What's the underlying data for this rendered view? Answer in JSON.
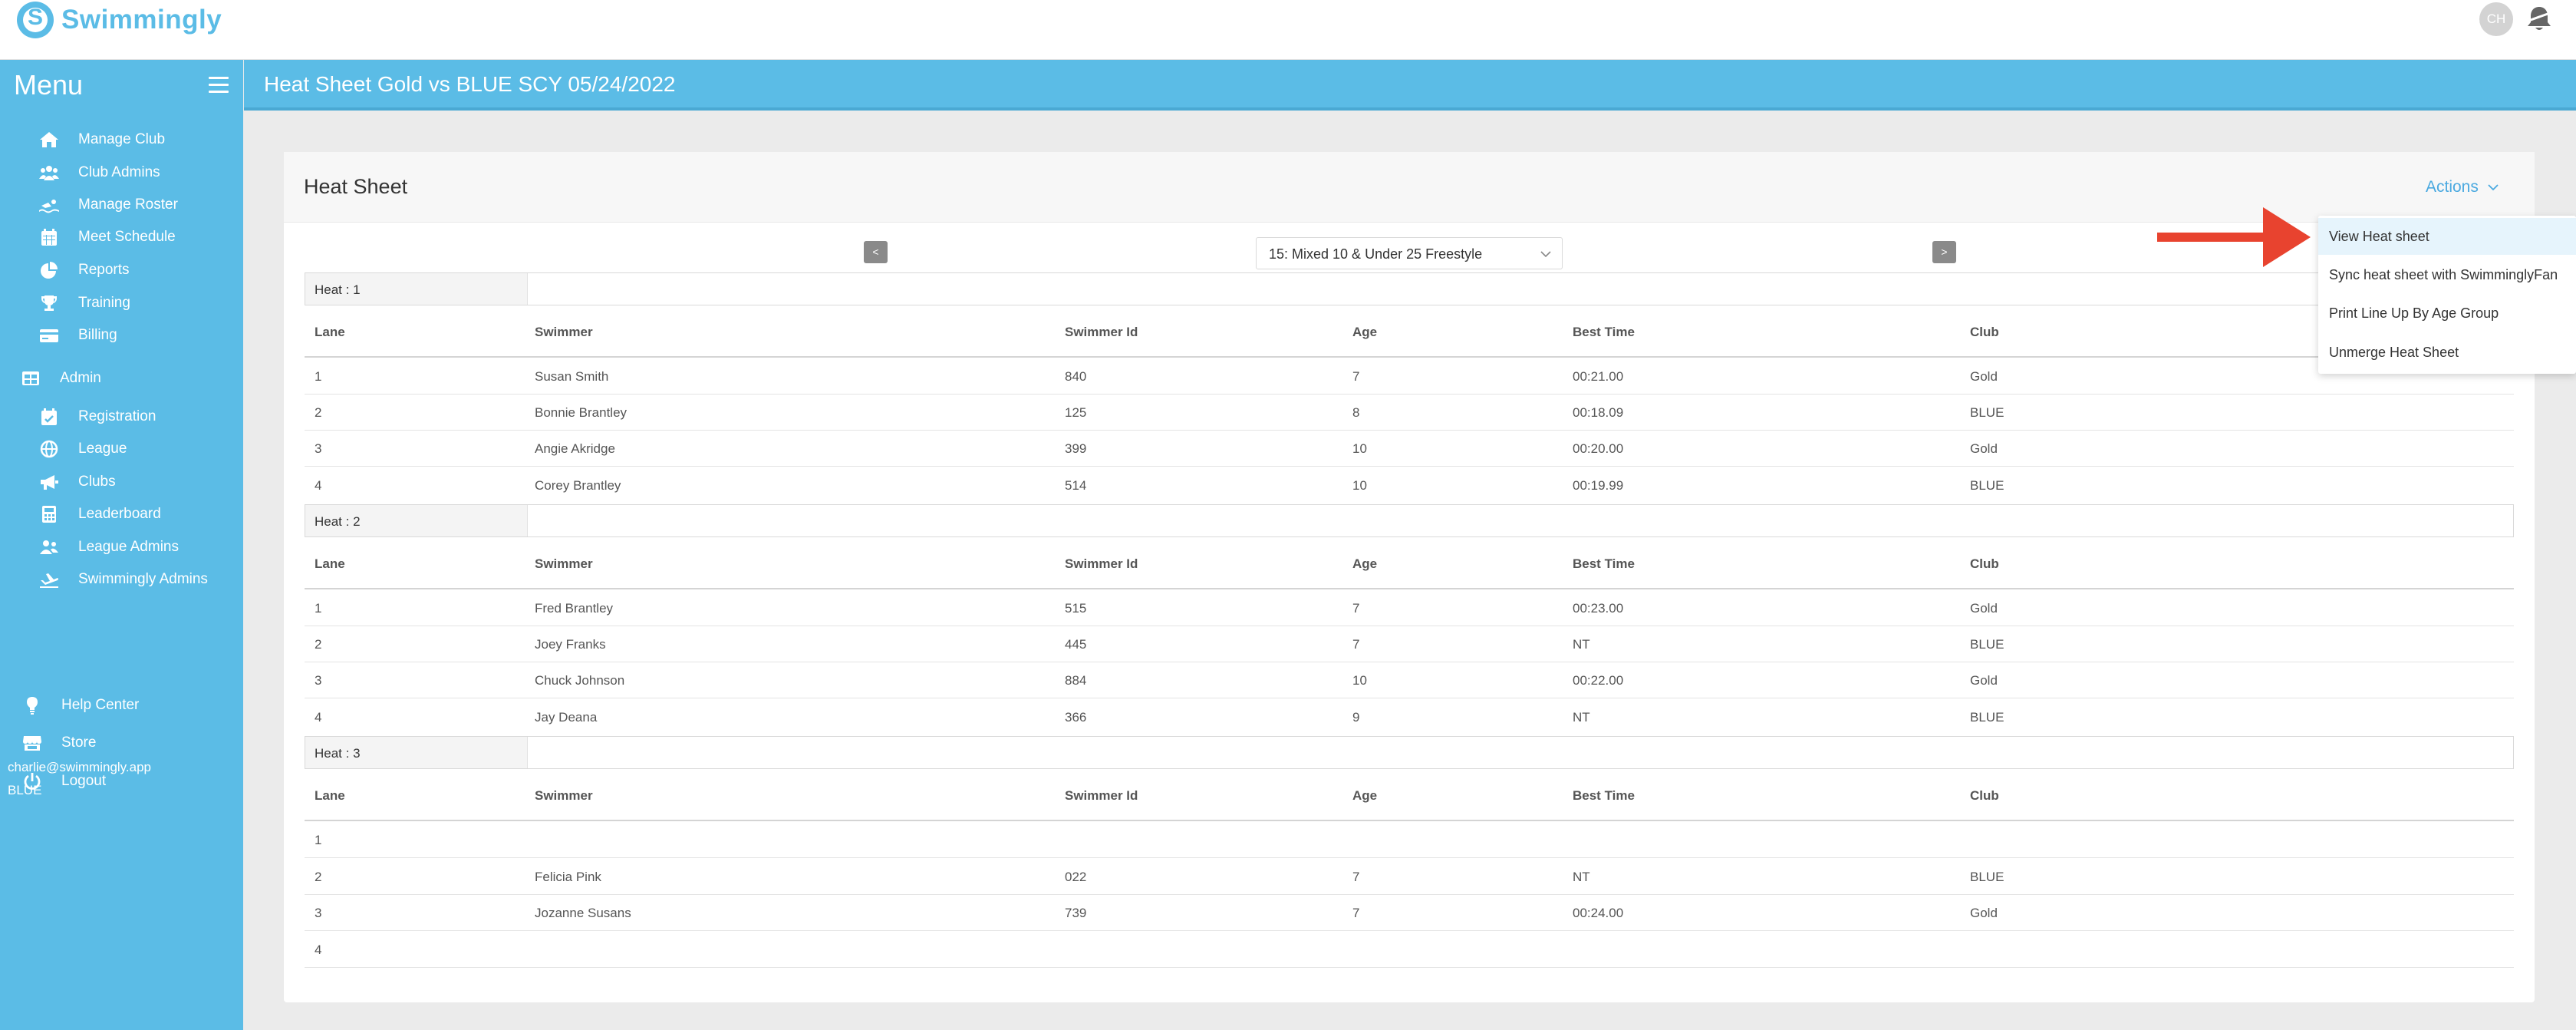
{
  "brand": {
    "name": "Swimmingly"
  },
  "user": {
    "initials": "CH",
    "email": "charlie@swimmingly.app",
    "club": "BLUE"
  },
  "sidebar": {
    "title": "Menu",
    "items": [
      {
        "label": "Manage Club",
        "icon": "home-icon"
      },
      {
        "label": "Club Admins",
        "icon": "users-icon"
      },
      {
        "label": "Manage Roster",
        "icon": "swimmer-icon"
      },
      {
        "label": "Meet Schedule",
        "icon": "calendar-icon"
      },
      {
        "label": "Reports",
        "icon": "pie-chart-icon"
      },
      {
        "label": "Training",
        "icon": "trophy-icon"
      },
      {
        "label": "Billing",
        "icon": "credit-card-icon"
      },
      {
        "label": "Admin",
        "icon": "table-icon"
      },
      {
        "label": "Registration",
        "icon": "calendar-check-icon"
      },
      {
        "label": "League",
        "icon": "globe-icon"
      },
      {
        "label": "Clubs",
        "icon": "megaphone-icon"
      },
      {
        "label": "Leaderboard",
        "icon": "calculator-icon"
      },
      {
        "label": "League Admins",
        "icon": "user-group-icon"
      },
      {
        "label": "Swimmingly Admins",
        "icon": "plane-icon"
      },
      {
        "label": "Help Center",
        "icon": "lightbulb-icon"
      },
      {
        "label": "Store",
        "icon": "store-icon"
      },
      {
        "label": "Logout",
        "icon": "power-icon"
      }
    ]
  },
  "header": {
    "title": "Heat Sheet Gold vs BLUE SCY 05/24/2022"
  },
  "card": {
    "title": "Heat Sheet",
    "actions_label": "Actions",
    "prev_label": "<",
    "next_label": ">",
    "event": "15: Mixed 10 & Under 25 Freestyle"
  },
  "columns": [
    "Lane",
    "Swimmer",
    "Swimmer Id",
    "Age",
    "Best Time",
    "Club"
  ],
  "heats": [
    {
      "label": "Heat : 1",
      "rows": [
        {
          "lane": "1",
          "swimmer": "Susan Smith",
          "id": "840",
          "age": "7",
          "time": "00:21.00",
          "club": "Gold"
        },
        {
          "lane": "2",
          "swimmer": "Bonnie Brantley",
          "id": "125",
          "age": "8",
          "time": "00:18.09",
          "club": "BLUE"
        },
        {
          "lane": "3",
          "swimmer": "Angie Akridge",
          "id": "399",
          "age": "10",
          "time": "00:20.00",
          "club": "Gold"
        },
        {
          "lane": "4",
          "swimmer": "Corey Brantley",
          "id": "514",
          "age": "10",
          "time": "00:19.99",
          "club": "BLUE"
        }
      ]
    },
    {
      "label": "Heat : 2",
      "rows": [
        {
          "lane": "1",
          "swimmer": "Fred Brantley",
          "id": "515",
          "age": "7",
          "time": "00:23.00",
          "club": "Gold"
        },
        {
          "lane": "2",
          "swimmer": "Joey Franks",
          "id": "445",
          "age": "7",
          "time": "NT",
          "club": "BLUE"
        },
        {
          "lane": "3",
          "swimmer": "Chuck Johnson",
          "id": "884",
          "age": "10",
          "time": "00:22.00",
          "club": "Gold"
        },
        {
          "lane": "4",
          "swimmer": "Jay Deana",
          "id": "366",
          "age": "9",
          "time": "NT",
          "club": "BLUE"
        }
      ]
    },
    {
      "label": "Heat : 3",
      "rows": [
        {
          "lane": "1",
          "swimmer": "",
          "id": "",
          "age": "",
          "time": "",
          "club": ""
        },
        {
          "lane": "2",
          "swimmer": "Felicia Pink",
          "id": "022",
          "age": "7",
          "time": "NT",
          "club": "BLUE"
        },
        {
          "lane": "3",
          "swimmer": "Jozanne Susans",
          "id": "739",
          "age": "7",
          "time": "00:24.00",
          "club": "Gold"
        },
        {
          "lane": "4",
          "swimmer": "",
          "id": "",
          "age": "",
          "time": "",
          "club": ""
        }
      ]
    }
  ],
  "actions_menu": [
    "View Heat sheet",
    "Sync heat sheet with SwimminglyFan",
    "Print Line Up By Age Group",
    "Unmerge Heat Sheet"
  ],
  "colors": {
    "brand": "#5bbce6",
    "link": "#4aa9e0",
    "arrow": "#e8432f"
  }
}
